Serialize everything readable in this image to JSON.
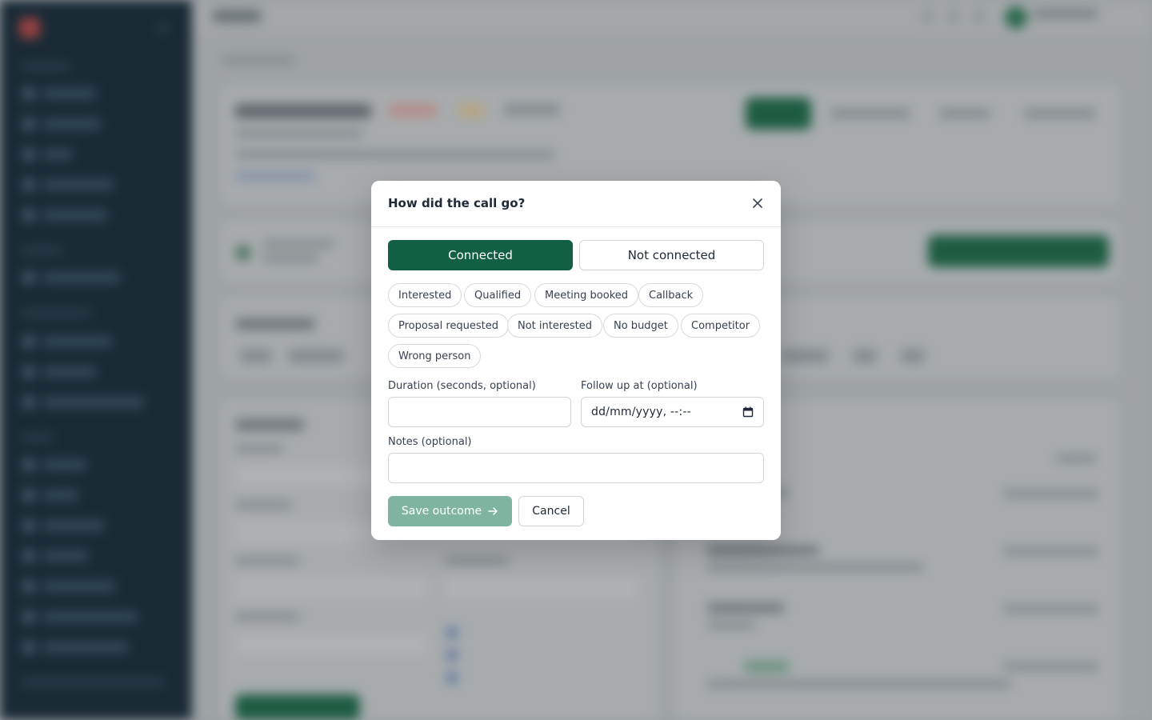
{
  "modal": {
    "title": "How did the call go?",
    "close_icon": "close-icon",
    "status_options": {
      "connected": "Connected",
      "not_connected": "Not connected",
      "selected": "Connected"
    },
    "outcomes": [
      "Interested",
      "Qualified",
      "Meeting booked",
      "Callback",
      "Proposal requested",
      "Not interested",
      "No budget",
      "Competitor",
      "Wrong person"
    ],
    "duration": {
      "label": "Duration (seconds, optional)",
      "value": ""
    },
    "follow_up": {
      "label": "Follow up at (optional)",
      "placeholder": "dd/mm/yyyy, --:--",
      "icon": "calendar-icon"
    },
    "notes": {
      "label": "Notes (optional)",
      "value": ""
    },
    "save_label": "Save outcome",
    "save_icon": "arrow-right-icon",
    "cancel_label": "Cancel"
  },
  "colors": {
    "primary": "#116044",
    "primary_disabled": "#7fb5a0",
    "sidebar": "#1a2e3a"
  }
}
